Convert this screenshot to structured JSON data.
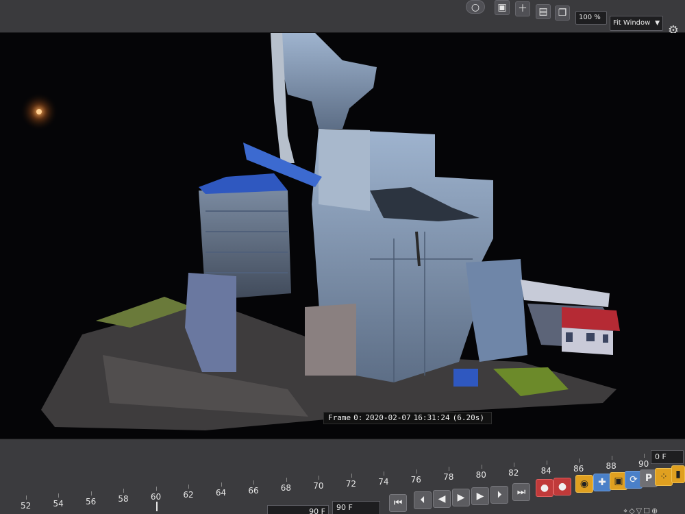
{
  "toolbar": {
    "icons": [
      "record-icon",
      "image-icon",
      "add-image-icon",
      "chart-icon",
      "copy-icon"
    ],
    "zoom_value": "100 %",
    "view_mode": "Fit Window",
    "gear_icon": "gear-icon"
  },
  "viewport": {
    "frame_label": "Frame",
    "frame_number": "0:",
    "frame_date": "2020-02-07",
    "frame_time": "16:31:24",
    "frame_duration": "(6.20s)"
  },
  "timeline": {
    "ticks": [
      "52",
      "54",
      "56",
      "58",
      "60",
      "62",
      "64",
      "66",
      "68",
      "70",
      "72",
      "74",
      "76",
      "78",
      "80",
      "82",
      "84",
      "86",
      "88",
      "90"
    ],
    "current_frame": "0 F",
    "end_frame_a": "90 F",
    "end_frame_b": "90 F",
    "playhead_frame": 60
  },
  "transport": {
    "go_start": "⏮",
    "prev_key": "⏴",
    "play": "▶",
    "next_key": "⏵",
    "go_end": "⏭",
    "record_key": "●",
    "autokey": "●",
    "motion_icon": "✚",
    "param_label": "P"
  },
  "colors": {
    "accent_red": "#c03a3a",
    "accent_orange": "#e0a020",
    "accent_blue": "#4a80c8"
  }
}
